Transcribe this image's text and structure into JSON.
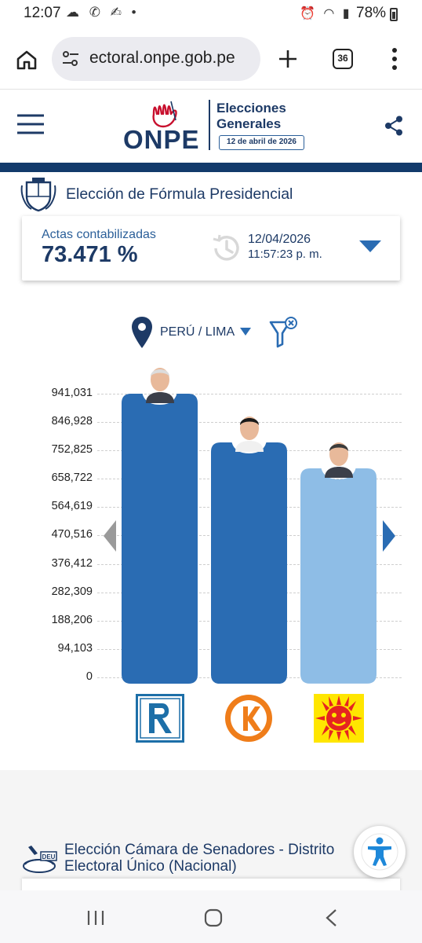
{
  "status_bar": {
    "time": "12:07",
    "left_icons": [
      "cloud-icon",
      "whatsapp-icon",
      "signature-icon",
      "dot-icon"
    ],
    "right_icons": [
      "alarm-icon",
      "wifi-icon",
      "signal-icon"
    ],
    "battery": "78%"
  },
  "browser": {
    "url": "ectoral.onpe.gob.pe",
    "tabs_count": "36"
  },
  "header": {
    "logo_text": "ONPE",
    "title_line1": "Elecciones",
    "title_line2": "Generales",
    "date_badge": "12 de abril de 2026"
  },
  "section1": {
    "title": "Elección de Fórmula Presidencial",
    "actas_label": "Actas contabilizadas",
    "actas_value": "73.471 %",
    "update_date": "12/04/2026",
    "update_time": "11:57:23 p. m."
  },
  "filter": {
    "region": "PERÚ / LIMA"
  },
  "chart_data": {
    "type": "bar",
    "categories": [
      "R",
      "K",
      "Sol"
    ],
    "values": [
      941031,
      780000,
      693000
    ],
    "ylim": [
      0,
      941031
    ],
    "yticks": [
      "941,031",
      "846,928",
      "752,825",
      "658,722",
      "564,619",
      "470,516",
      "376,412",
      "282,309",
      "188,206",
      "94,103",
      "0"
    ],
    "ytick_values": [
      941031,
      846928,
      752825,
      658722,
      564619,
      470516,
      376412,
      282309,
      188206,
      94103,
      0
    ],
    "bar_colors": [
      "#2a6cb3",
      "#2a6cb3",
      "#8ebde6"
    ],
    "grid": true
  },
  "section2": {
    "title_line1": "Elección Cámara de Senadores - Distrito",
    "title_line2": "Electoral Único (Nacional)",
    "badge": "DEU"
  },
  "colors": {
    "primary": "#1d3a66",
    "accent_blue": "#2a6cb3",
    "light_blue": "#8ebde6",
    "logo_red": "#c8102e"
  }
}
